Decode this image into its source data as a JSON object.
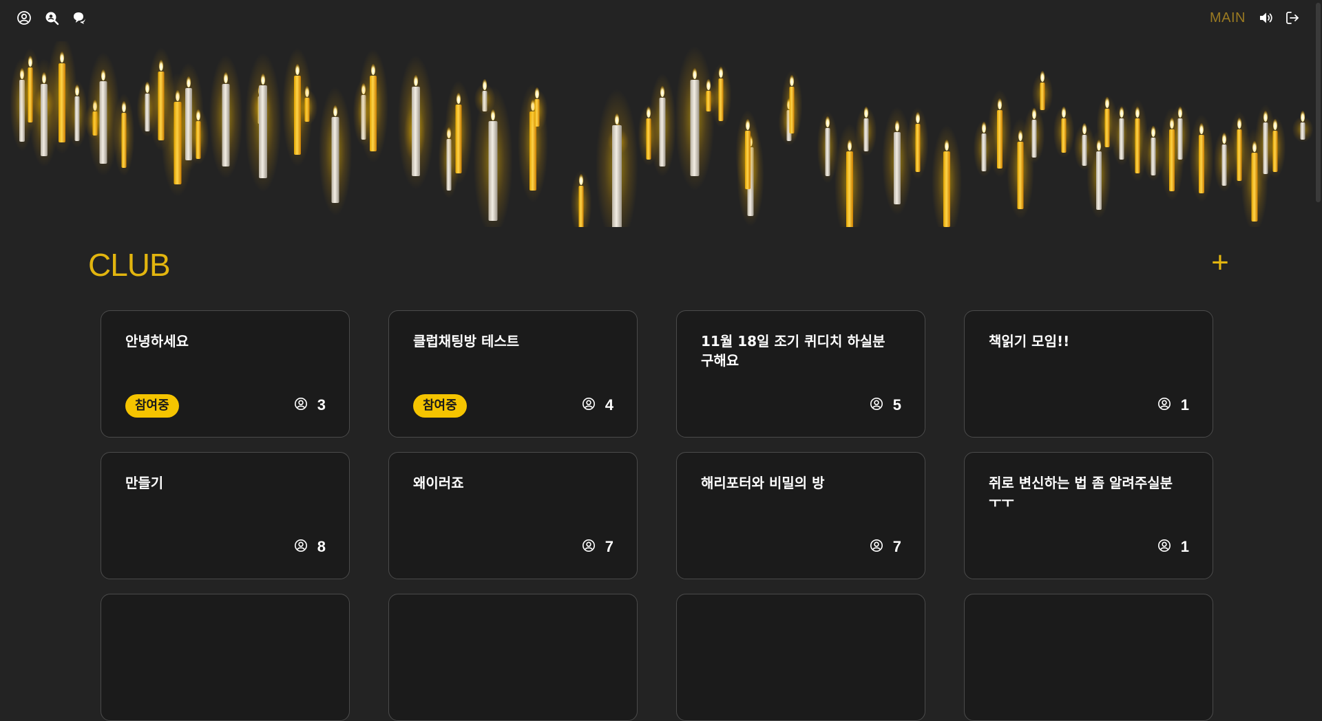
{
  "header": {
    "main_label": "MAIN",
    "icons": [
      "user-icon",
      "search-user-icon",
      "chat-icon",
      "speaker-icon",
      "logout-icon"
    ]
  },
  "section": {
    "title": "CLUB",
    "add_label": "+"
  },
  "colors": {
    "background": "#232323",
    "card": "#1b1b1b",
    "accent": "#e2b50f",
    "badge": "#f5c400"
  },
  "clubs": [
    {
      "title": "안녕하세요",
      "badge": "참여중",
      "members": "3"
    },
    {
      "title": "클럽채팅방 테스트",
      "badge": "참여중",
      "members": "4"
    },
    {
      "title": "11월 18일 조기 퀴디치 하실분 구해요",
      "badge": "",
      "members": "5"
    },
    {
      "title": "책읽기 모임!!",
      "badge": "",
      "members": "1"
    },
    {
      "title": "만들기",
      "badge": "",
      "members": "8"
    },
    {
      "title": "왜이러죠",
      "badge": "",
      "members": "7"
    },
    {
      "title": "해리포터와 비밀의 방",
      "badge": "",
      "members": "7"
    },
    {
      "title": "쥐로 변신하는 법 좀 알려주실분 ㅜㅜ",
      "badge": "",
      "members": "1"
    }
  ]
}
